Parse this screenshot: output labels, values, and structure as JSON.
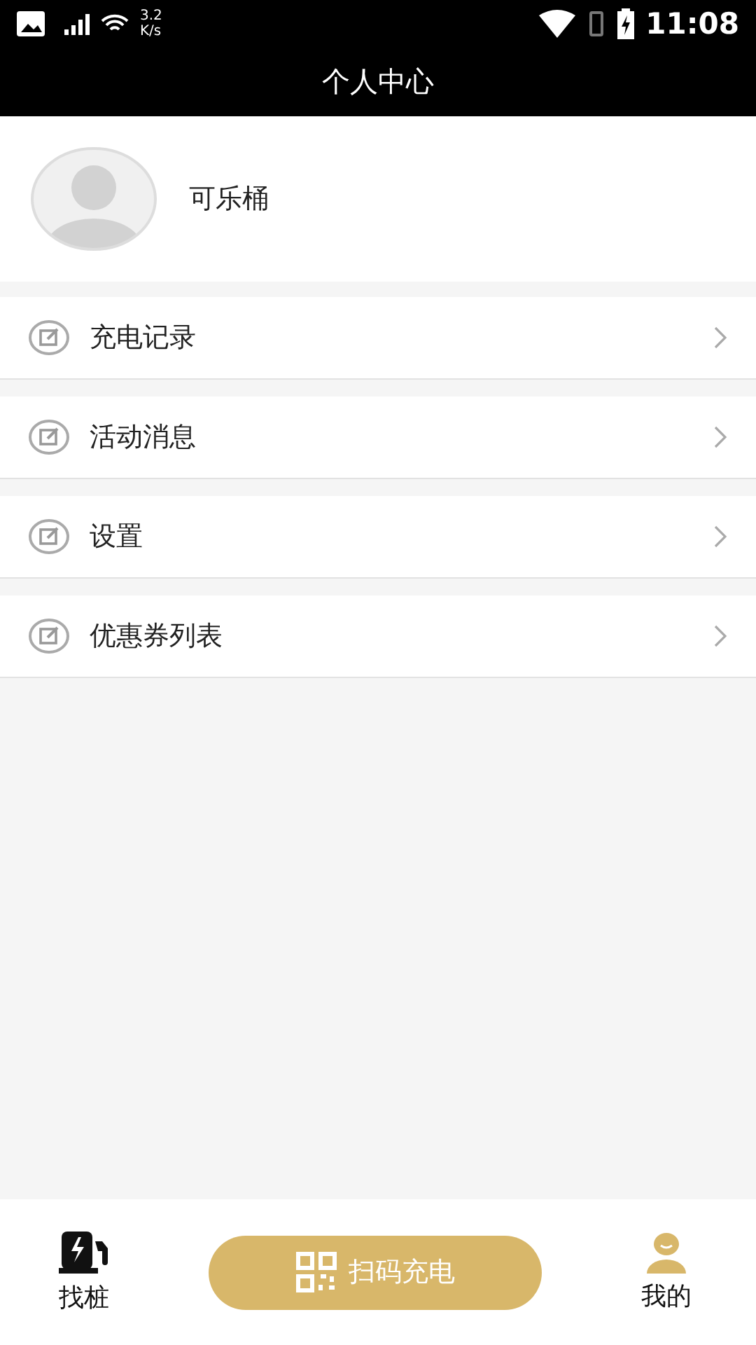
{
  "status_bar": {
    "speed": "3.2 K/s",
    "time": "11:08"
  },
  "header": {
    "title": "个人中心"
  },
  "profile": {
    "name": "可乐桶"
  },
  "menu": [
    {
      "label": "充电记录"
    },
    {
      "label": "活动消息"
    },
    {
      "label": "设置"
    },
    {
      "label": "优惠券列表"
    }
  ],
  "bottom_nav": {
    "items": [
      {
        "kind": "station",
        "label": "找桩",
        "selected": false
      },
      {
        "kind": "user",
        "label": "我的",
        "selected": true
      }
    ],
    "scan_button": {
      "label": "扫码充电"
    }
  }
}
